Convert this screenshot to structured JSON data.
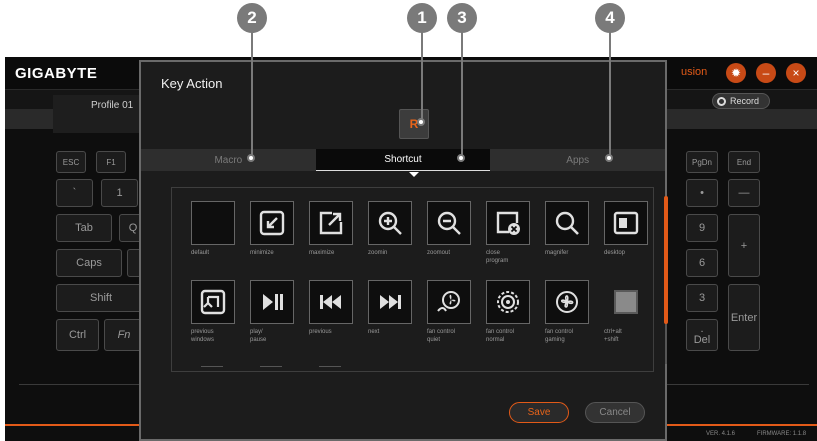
{
  "callouts": [
    "2",
    "1",
    "3",
    "4"
  ],
  "app": {
    "brand": "GIGABYTE",
    "fusion_label": "usion",
    "profile": "Profile 01",
    "record_label": "Record",
    "version": "VER. 4.1.6",
    "firmware": "FIRMWARE: 1.1.8"
  },
  "keys": {
    "esc": "ESC",
    "f1": "F1",
    "backtick": "`",
    "one": "1",
    "tab": "Tab",
    "q": "Q",
    "caps": "Caps",
    "shift": "Shift",
    "ctrl": "Ctrl",
    "fn": "Fn",
    "pgdn": "PgDn",
    "end": "End",
    "dot": "•",
    "minus": "—",
    "nine": "9",
    "plus": "+",
    "six": "6",
    "three": "3",
    "enter": "Enter",
    "del_dot": ".",
    "del": "Del"
  },
  "dialog": {
    "title": "Key Action",
    "key_preview": "R",
    "tabs": [
      "Macro",
      "Shortcut",
      "Apps"
    ],
    "active_tab": "Shortcut",
    "shortcuts": [
      {
        "label": "default",
        "icon": "blank-icon"
      },
      {
        "label": "minimize",
        "icon": "minimize-icon"
      },
      {
        "label": "maximize",
        "icon": "maximize-icon"
      },
      {
        "label": "zoomin",
        "icon": "zoom-in-icon"
      },
      {
        "label": "zoomout",
        "icon": "zoom-out-icon"
      },
      {
        "label": "close\nprogram",
        "icon": "close-program-icon"
      },
      {
        "label": "magnifer",
        "icon": "magnifier-icon"
      },
      {
        "label": "desktop",
        "icon": "desktop-icon"
      },
      {
        "label": "previous\nwindows",
        "icon": "previous-windows-icon"
      },
      {
        "label": "play/\npause",
        "icon": "play-pause-icon"
      },
      {
        "label": "previous",
        "icon": "previous-track-icon"
      },
      {
        "label": "next",
        "icon": "next-track-icon"
      },
      {
        "label": "fan control\nquiet",
        "icon": "fan-quiet-icon"
      },
      {
        "label": "fan control\nnormal",
        "icon": "fan-normal-icon"
      },
      {
        "label": "fan control\ngaming",
        "icon": "fan-gaming-icon"
      },
      {
        "label": "ctrl+alt\n+shift",
        "icon": "ctrl-alt-shift-icon"
      }
    ],
    "save_label": "Save",
    "cancel_label": "Cancel"
  },
  "colors": {
    "accent": "#e25a18",
    "callout": "#7a7a7a"
  }
}
